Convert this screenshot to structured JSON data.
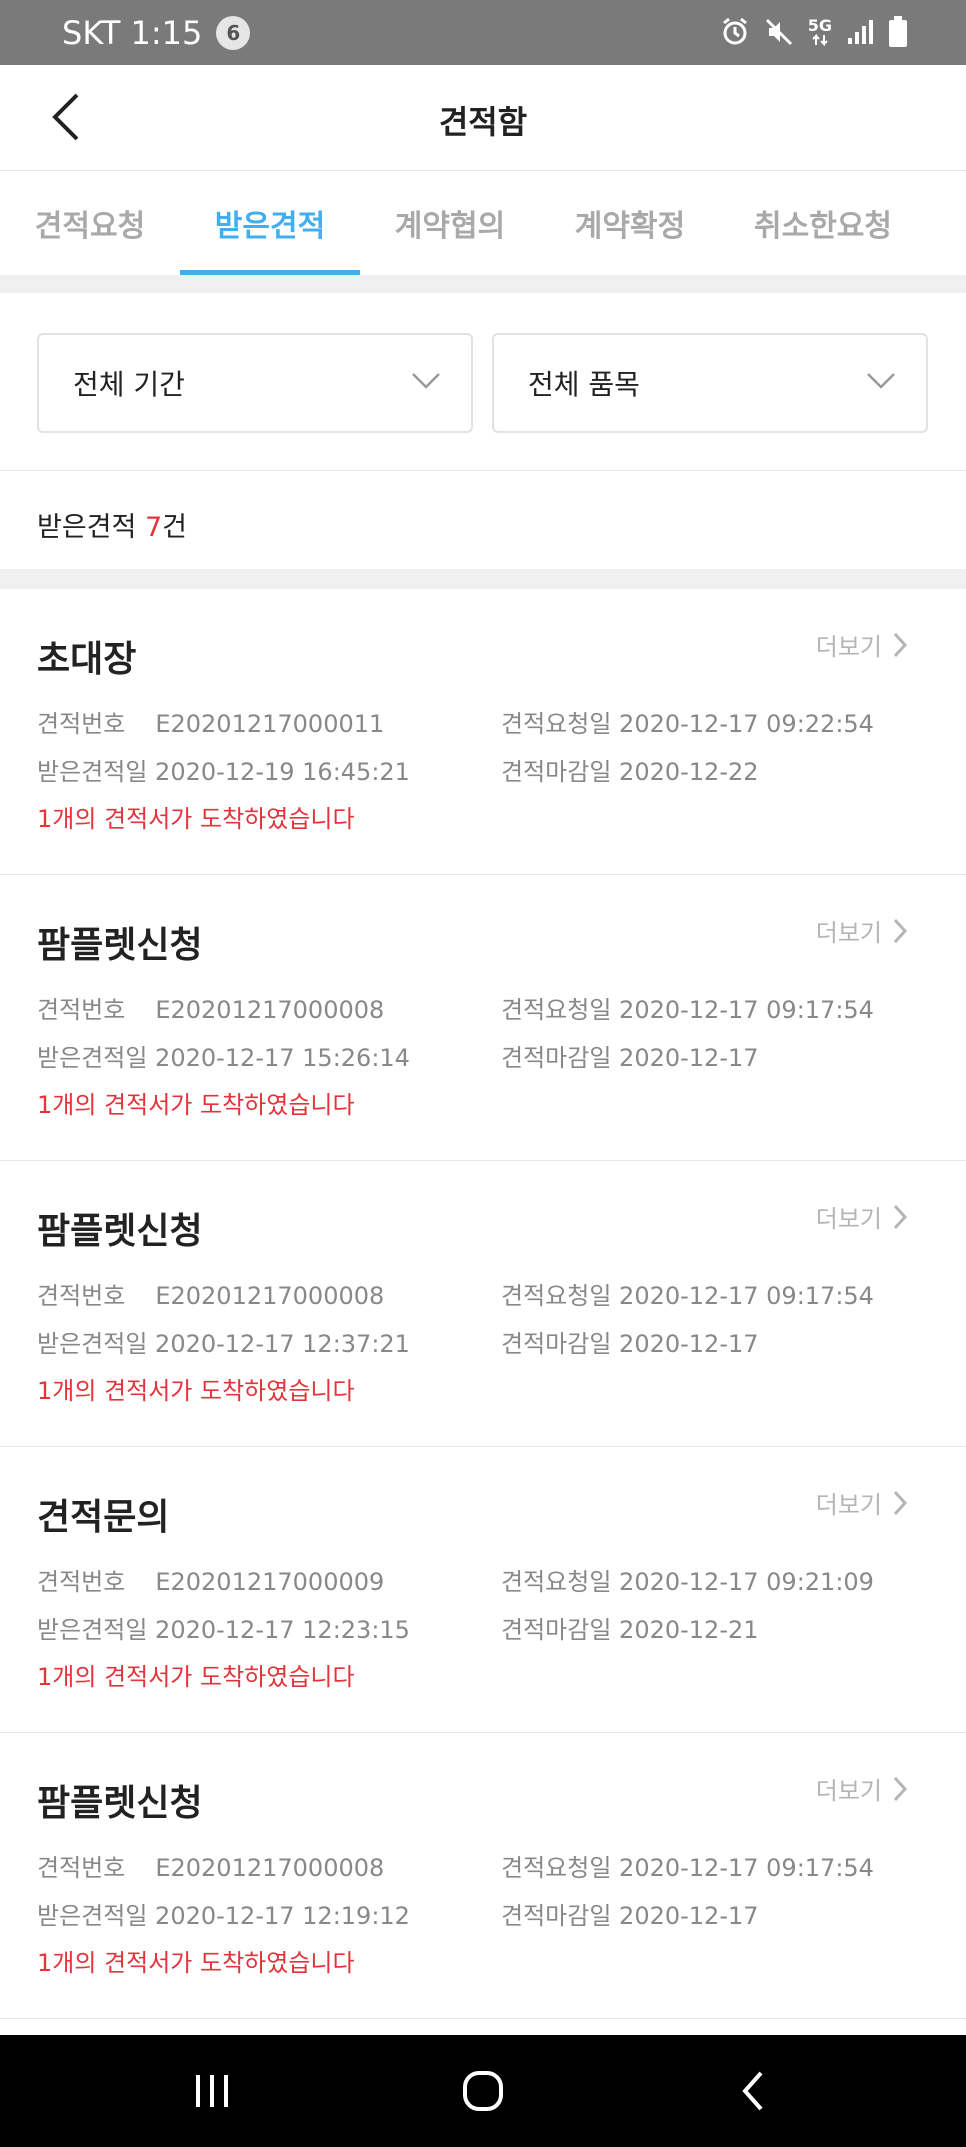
{
  "status_bar": {
    "carrier_time": "SKT 1:15",
    "notification_count": "6",
    "network": "5G",
    "icons": [
      "alarm-icon",
      "mute-icon",
      "5g-icon",
      "signal-icon",
      "battery-icon"
    ]
  },
  "header": {
    "title": "견적함",
    "back_icon": "chevron-left-icon"
  },
  "tabs": [
    {
      "label": "견적요청",
      "active": false
    },
    {
      "label": "받은견적",
      "active": true
    },
    {
      "label": "계약협의",
      "active": false
    },
    {
      "label": "계약확정",
      "active": false
    },
    {
      "label": "취소한요청",
      "active": false
    }
  ],
  "filters": {
    "period": "전체 기간",
    "category": "전체 품목"
  },
  "summary": {
    "prefix": "받은견적 ",
    "count": "7",
    "suffix": "건"
  },
  "labels": {
    "more": "더보기",
    "quote_no": "견적번호",
    "received_date": "받은견적일",
    "request_date": "견적요청일",
    "deadline": "견적마감일"
  },
  "quotes": [
    {
      "title": "초대장",
      "quote_no": "E20201217000011",
      "request_date": "2020-12-17 09:22:54",
      "received_date": "2020-12-19 16:45:21",
      "deadline": "2020-12-22",
      "message": "1개의 견적서가 도착하였습니다"
    },
    {
      "title": "팜플렛신청",
      "quote_no": "E20201217000008",
      "request_date": "2020-12-17 09:17:54",
      "received_date": "2020-12-17 15:26:14",
      "deadline": "2020-12-17",
      "message": "1개의 견적서가 도착하였습니다"
    },
    {
      "title": "팜플렛신청",
      "quote_no": "E20201217000008",
      "request_date": "2020-12-17 09:17:54",
      "received_date": "2020-12-17 12:37:21",
      "deadline": "2020-12-17",
      "message": "1개의 견적서가 도착하였습니다"
    },
    {
      "title": "견적문의",
      "quote_no": "E20201217000009",
      "request_date": "2020-12-17 09:21:09",
      "received_date": "2020-12-17 12:23:15",
      "deadline": "2020-12-21",
      "message": "1개의 견적서가 도착하였습니다"
    },
    {
      "title": "팜플렛신청",
      "quote_no": "E20201217000008",
      "request_date": "2020-12-17 09:17:54",
      "received_date": "2020-12-17 12:19:12",
      "deadline": "2020-12-17",
      "message": "1개의 견적서가 도착하였습니다"
    }
  ],
  "colors": {
    "accent": "#41aef0",
    "alert": "#e3343b",
    "muted": "#888888",
    "status_bar": "#7a7a7a"
  },
  "nav_bar": {
    "icons": [
      "recent-apps-icon",
      "home-icon",
      "back-icon"
    ]
  }
}
